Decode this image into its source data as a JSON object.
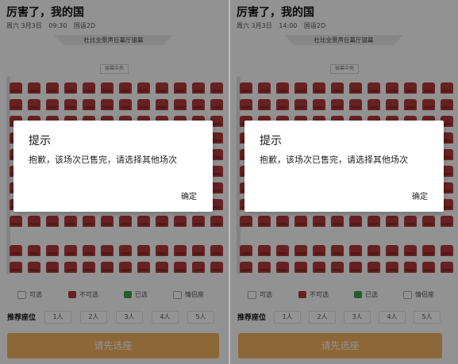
{
  "left": {
    "title": "厉害了，我的国",
    "meta": {
      "date": "周六 3月3日",
      "time": "09:30",
      "lang": "国语2D"
    },
    "screen_name": "杜比全景声巨幕厅银幕",
    "center_tag": "银幕中央",
    "legend": {
      "available": "可选",
      "unavailable": "不可选",
      "selected": "已选",
      "couple": "情侣座"
    },
    "recommend": {
      "label": "推荐座位",
      "options": [
        "1人",
        "2人",
        "3人",
        "4人",
        "5人"
      ]
    },
    "cta": "请先选座",
    "dialog": {
      "title": "提示",
      "message": "抱歉，该场次已售完，请选择其他场次",
      "confirm": "确定"
    }
  },
  "right": {
    "title": "厉害了，我的国",
    "meta": {
      "date": "周六 3月3日",
      "time": "14:00",
      "lang": "国语2D"
    },
    "screen_name": "杜比全景声巨幕厅银幕",
    "center_tag": "银幕中央",
    "legend": {
      "available": "可选",
      "unavailable": "不可选",
      "selected": "已选",
      "couple": "情侣座"
    },
    "recommend": {
      "label": "推荐座位",
      "options": [
        "1人",
        "2人",
        "3人",
        "4人",
        "5人"
      ]
    },
    "cta": "请先选座",
    "dialog": {
      "title": "提示",
      "message": "抱歉，该场次已售完，请选择其他场次",
      "confirm": "确定"
    }
  },
  "colors": {
    "seat_unavailable": "#b23a3a",
    "seat_selected": "#3aa04a",
    "cta": "#f2b15f",
    "overlay": "rgba(0,0,0,0.42)"
  },
  "icons": [
    "seat-icon"
  ]
}
